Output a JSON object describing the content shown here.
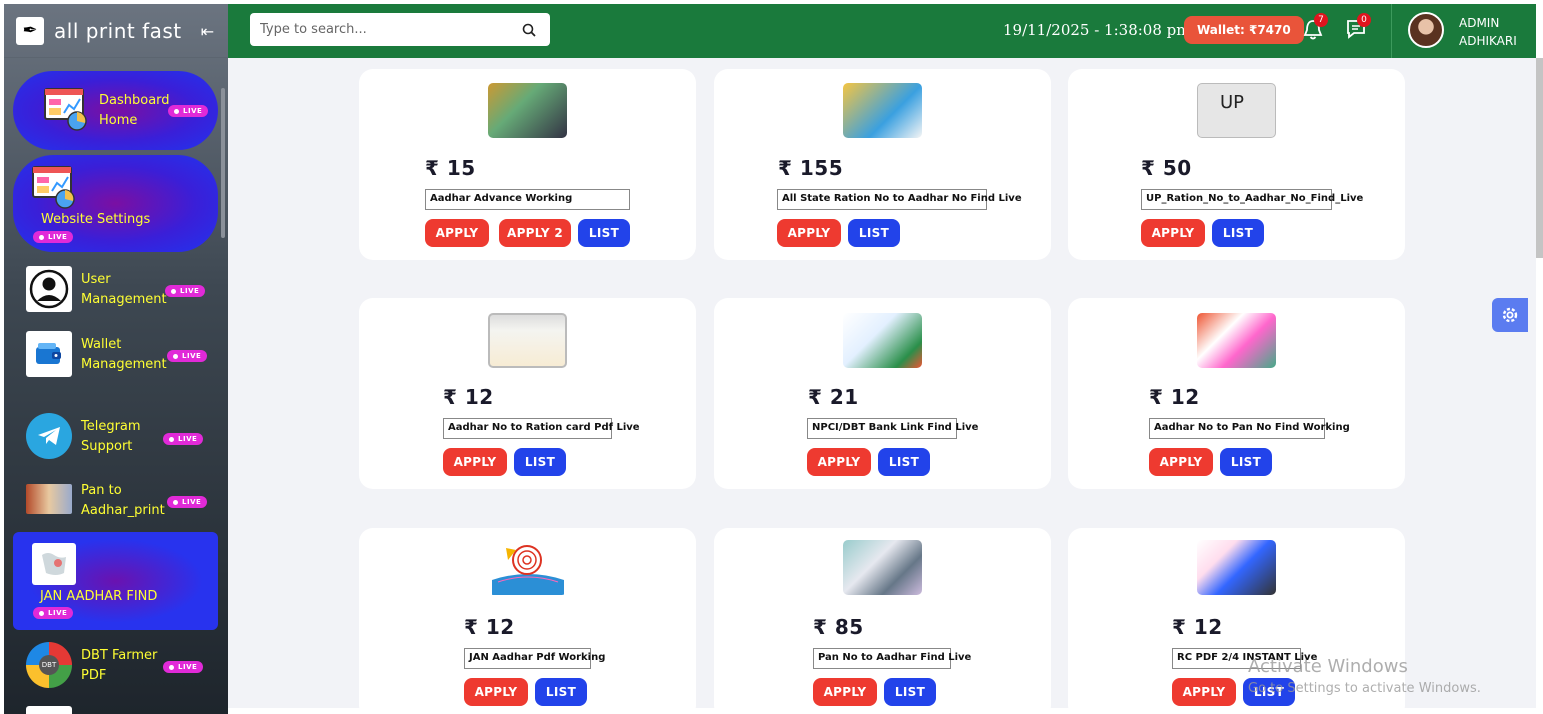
{
  "brand": {
    "name": "all print fast"
  },
  "sidebar": {
    "items": [
      {
        "label": "Dashboard Home",
        "badge": "LIVE"
      },
      {
        "label": "Website Settings",
        "badge": "LIVE"
      },
      {
        "label": "User Management",
        "badge": "LIVE"
      },
      {
        "label": "Wallet Management",
        "badge": "LIVE"
      },
      {
        "label": "Telegram Support",
        "badge": "LIVE"
      },
      {
        "label": "Pan to Aadhar_print",
        "badge": "LIVE"
      },
      {
        "label": "JAN AADHAR FIND",
        "badge": "LIVE"
      },
      {
        "label": "DBT Farmer PDF",
        "badge": "LIVE"
      }
    ]
  },
  "header": {
    "search_placeholder": "Type to search...",
    "datetime": "19/11/2025 - 1:38:08 pm",
    "wallet": "Wallet: ₹7470",
    "notifications": "7",
    "messages": "0",
    "user_line1": "ADMIN",
    "user_line2": "ADHIKARI"
  },
  "colors": {
    "header": "#1a7a3c",
    "apply": "#ee3a30",
    "list": "#2243ea",
    "wallet": "#e9543a"
  },
  "cards": [
    {
      "price": "₹ 15",
      "name": "Aadhar Advance Working",
      "buttons": [
        "APPLY",
        "APPLY 2",
        "LIST"
      ]
    },
    {
      "price": "₹ 155",
      "name": "All State Ration No to Aadhar No Find Live",
      "buttons": [
        "APPLY",
        "LIST"
      ]
    },
    {
      "price": "₹ 50",
      "name": "UP_Ration_No_to_Aadhar_No_Find_Live",
      "buttons": [
        "APPLY",
        "LIST"
      ],
      "thumb_text": "UP"
    },
    {
      "price": "₹ 12",
      "name": "Aadhar No to Ration card Pdf Live",
      "buttons": [
        "APPLY",
        "LIST"
      ]
    },
    {
      "price": "₹ 21",
      "name": "NPCI/DBT Bank Link Find Live",
      "buttons": [
        "APPLY",
        "LIST"
      ]
    },
    {
      "price": "₹ 12",
      "name": "Aadhar No to Pan No Find Working",
      "buttons": [
        "APPLY",
        "LIST"
      ]
    },
    {
      "price": "₹ 12",
      "name": "JAN Aadhar Pdf Working",
      "buttons": [
        "APPLY",
        "LIST"
      ]
    },
    {
      "price": "₹ 85",
      "name": "Pan No to Aadhar Find Live",
      "buttons": [
        "APPLY",
        "LIST"
      ]
    },
    {
      "price": "₹ 12",
      "name": "RC PDF 2/4 INSTANT Live",
      "buttons": [
        "APPLY",
        "LIST"
      ]
    }
  ],
  "watermark": {
    "line1": "Activate Windows",
    "line2": "Go to Settings to activate Windows."
  }
}
